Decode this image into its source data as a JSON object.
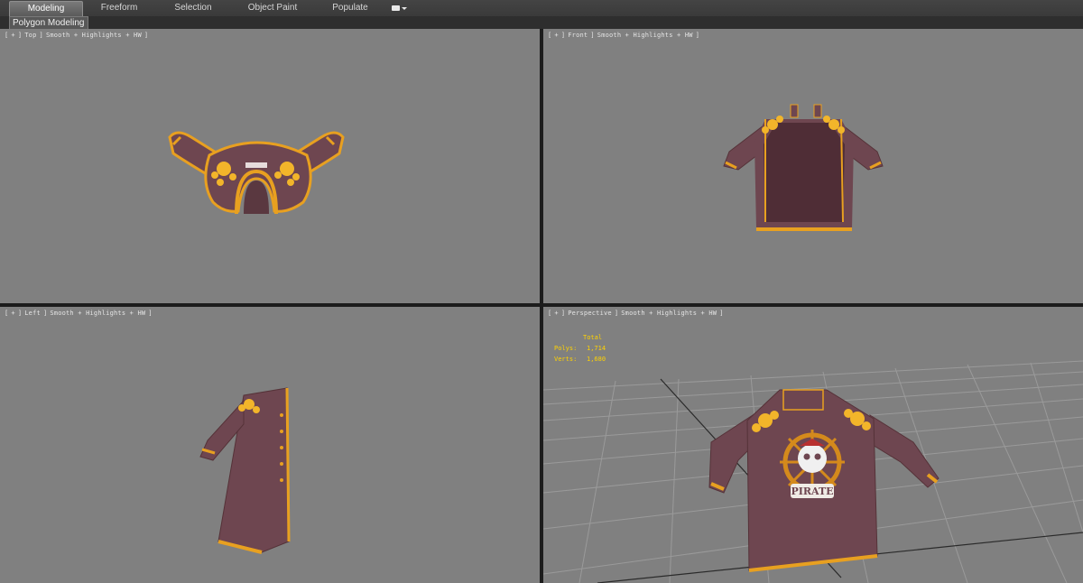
{
  "ribbon": {
    "tabs": [
      "Modeling",
      "Freeform",
      "Selection",
      "Object Paint",
      "Populate"
    ],
    "active_tab": "Modeling"
  },
  "subbar": {
    "button_label": "Polygon Modeling"
  },
  "viewports": [
    {
      "id": "top",
      "label": [
        "[",
        "+",
        "]",
        "Top",
        "]",
        "Smooth + Highlights + HW",
        "]"
      ]
    },
    {
      "id": "front",
      "label": [
        "[",
        "+",
        "]",
        "Front",
        "]",
        "Smooth + Highlights + HW",
        "]"
      ]
    },
    {
      "id": "left",
      "label": [
        "[",
        "+",
        "]",
        "Left",
        "]",
        "Smooth + Highlights + HW",
        "]"
      ]
    },
    {
      "id": "perspective",
      "label": [
        "[",
        "+",
        "]",
        "Perspective",
        "]",
        "Smooth + Highlights + HW",
        "]"
      ]
    }
  ],
  "stats": {
    "header": "Total",
    "polys_label": "Polys:",
    "polys_value": "1,714",
    "verts_label": "Verts:",
    "verts_value": "1,680"
  },
  "model": {
    "emblem_text": "PIRATE"
  },
  "colors": {
    "viewport_bg": "#808080",
    "jacket": "#6e4650",
    "trim": "#e8a020",
    "stats_text": "#ffd200"
  }
}
